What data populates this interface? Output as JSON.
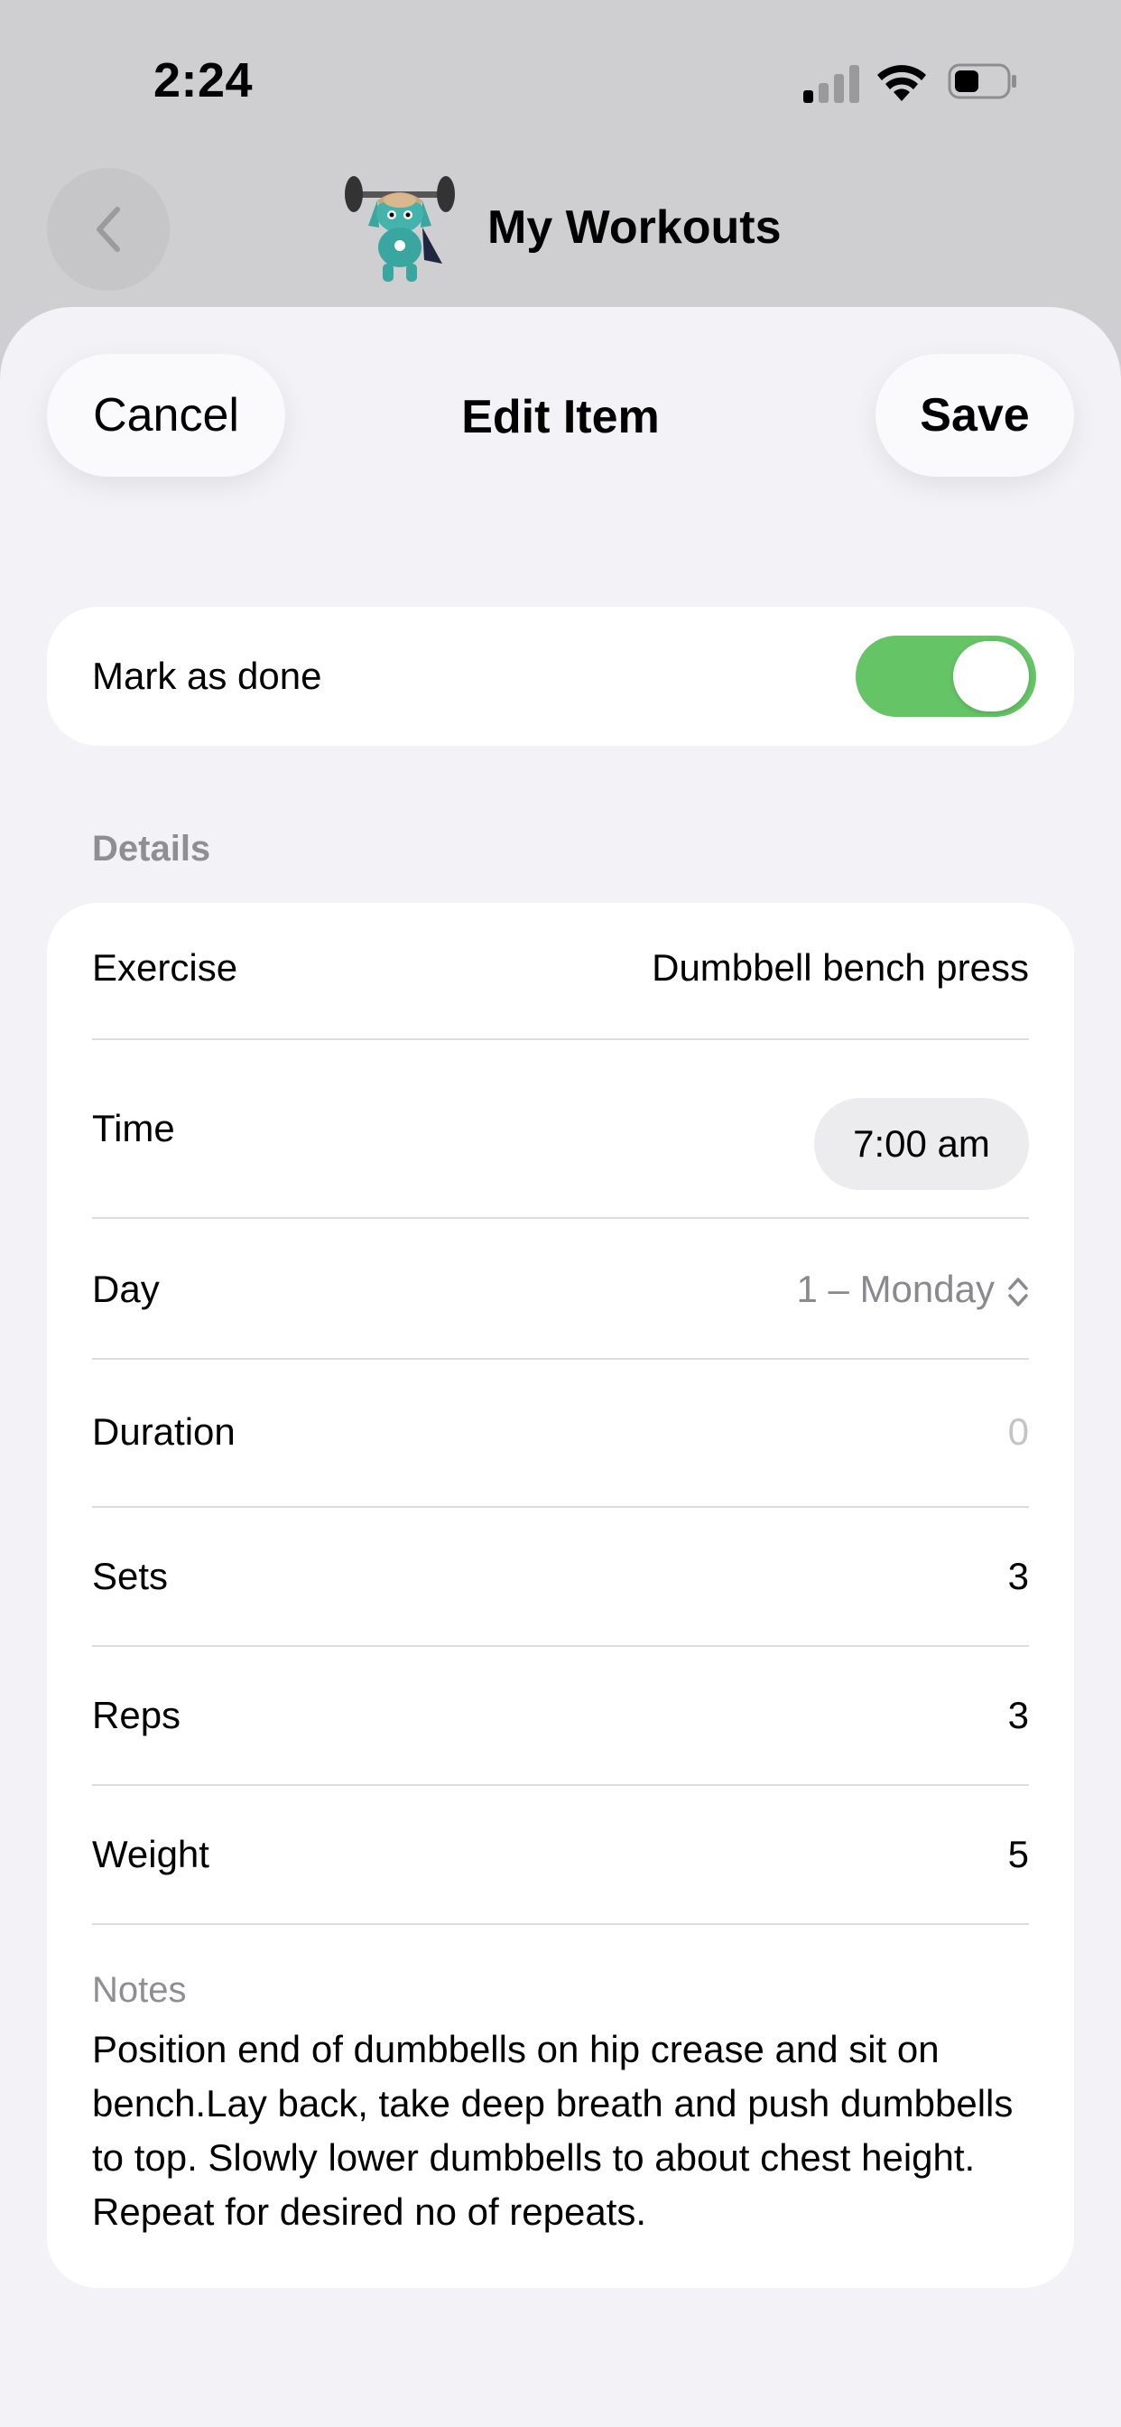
{
  "status_bar": {
    "time": "2:24",
    "icons": [
      "cellular-signal-icon",
      "wifi-icon",
      "battery-icon"
    ]
  },
  "nav": {
    "back_icon": "chevron-left-icon",
    "mascot_icon": "weightlifter-mascot-icon",
    "title": "My Workouts"
  },
  "sheet": {
    "cancel_label": "Cancel",
    "title": "Edit Item",
    "save_label": "Save"
  },
  "done": {
    "label": "Mark as done",
    "toggle_on": true,
    "toggle_color": "#65c466"
  },
  "details": {
    "header": "Details",
    "exercise": {
      "label": "Exercise",
      "value": "Dumbbell bench press"
    },
    "time": {
      "label": "Time",
      "value": "7:00 am"
    },
    "day": {
      "label": "Day",
      "value": "1 – Monday",
      "icon": "chevron-up-down-icon"
    },
    "duration": {
      "label": "Duration",
      "placeholder": "0"
    },
    "sets": {
      "label": "Sets",
      "value": "3"
    },
    "reps": {
      "label": "Reps",
      "value": "3"
    },
    "weight": {
      "label": "Weight",
      "value": "5"
    },
    "notes": {
      "label": "Notes",
      "text": "Position end of dumbbells on hip crease and sit on bench.Lay back, take deep breath and push dumbbells to top. Slowly lower dumbbells to about chest height. Repeat for desired no of repeats."
    }
  }
}
